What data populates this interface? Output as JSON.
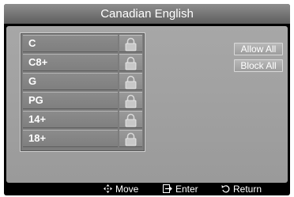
{
  "header": {
    "title": "Canadian English"
  },
  "ratings": [
    {
      "label": "C",
      "lock_icon": "lock-icon"
    },
    {
      "label": "C8+",
      "lock_icon": "lock-icon"
    },
    {
      "label": "G",
      "lock_icon": "lock-icon"
    },
    {
      "label": "PG",
      "lock_icon": "lock-icon"
    },
    {
      "label": "14+",
      "lock_icon": "lock-icon"
    },
    {
      "label": "18+",
      "lock_icon": "lock-icon"
    }
  ],
  "buttons": {
    "allow_all": "Allow All",
    "block_all": "Block All"
  },
  "footer": {
    "move": {
      "icon": "move-arrows-icon",
      "label": "Move"
    },
    "enter": {
      "icon": "enter-icon",
      "label": "Enter"
    },
    "return": {
      "icon": "return-icon",
      "label": "Return"
    }
  },
  "colors": {
    "background": "#000000",
    "panel": "#a0a0a0",
    "text": "#ffffff"
  }
}
